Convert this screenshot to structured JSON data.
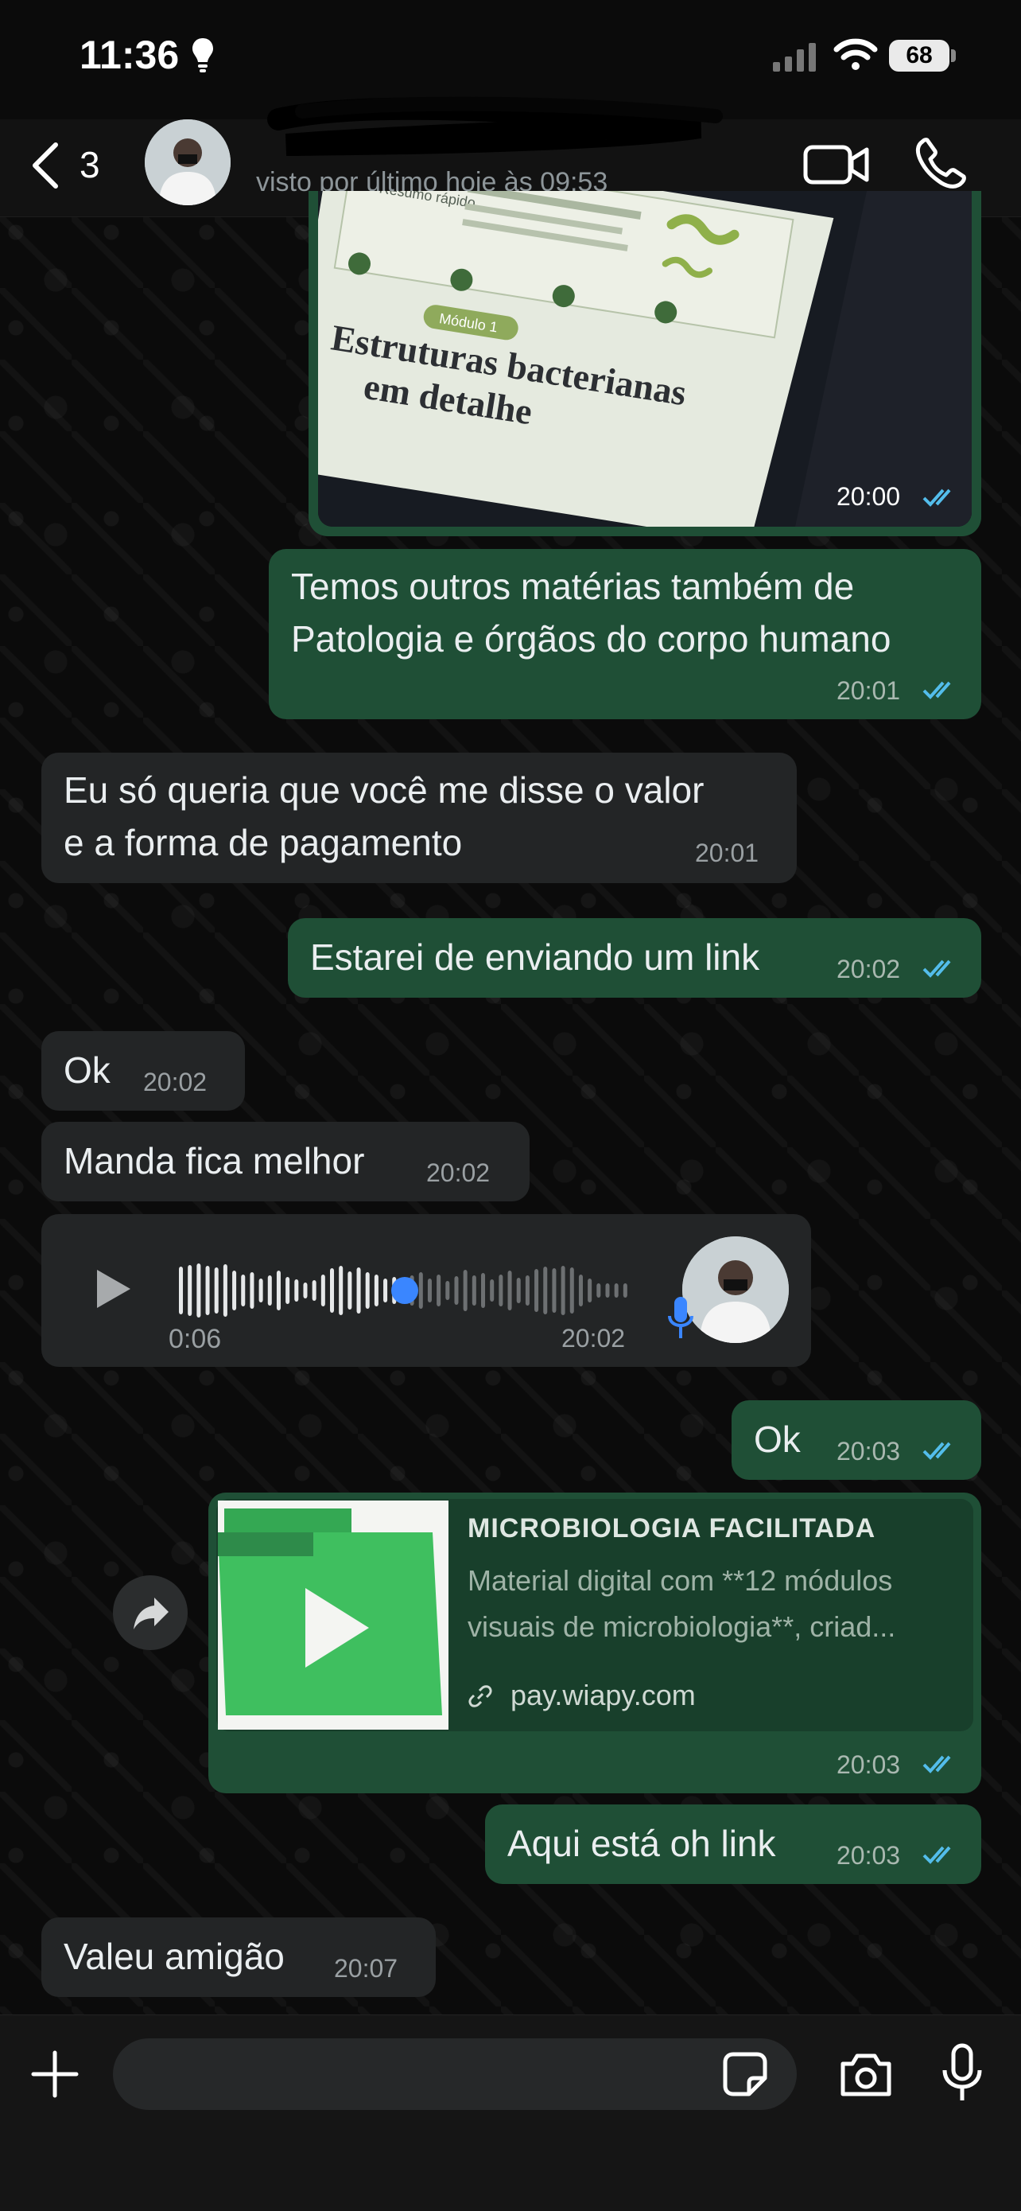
{
  "status_bar": {
    "time": "11:36",
    "battery": "68"
  },
  "header": {
    "back_count": "3",
    "last_seen": "visto por último hoje às 09:53"
  },
  "image_message": {
    "caption_lines": [
      "Estruturas bacterianas",
      "em detalhe"
    ],
    "module_label": "Módulo 1",
    "summary_label": "Resumo rápido",
    "time": "20:00"
  },
  "messages": {
    "m1": {
      "text": "Temos outros matérias também de\nPatologia e órgãos do corpo humano",
      "time": "20:01"
    },
    "m2": {
      "text": "Eu só queria que você me disse o valor\ne a forma de pagamento",
      "time": "20:01"
    },
    "m3": {
      "text": "Estarei de enviando um link",
      "time": "20:02"
    },
    "m4": {
      "text": "Ok",
      "time": "20:02"
    },
    "m5": {
      "text": "Manda fica melhor",
      "time": "20:02"
    },
    "voice": {
      "duration": "0:06",
      "time": "20:02",
      "progress": 0.5
    },
    "m6": {
      "text": "Ok",
      "time": "20:03"
    },
    "link": {
      "title": "MICROBIOLOGIA FACILITADA",
      "description": "Material digital com **12 módulos visuais de microbiologia**, criad...",
      "domain": "pay.wiapy.com",
      "time": "20:03"
    },
    "m7": {
      "text": "Aqui está oh link",
      "time": "20:03"
    },
    "m8": {
      "text": "Valeu amigão",
      "time": "20:07"
    }
  },
  "composer": {
    "placeholder": ""
  },
  "colors": {
    "outgoing": "#1f4f36",
    "incoming": "#232526",
    "read_ticks": "#53bdeb",
    "accent": "#3a86ff"
  }
}
